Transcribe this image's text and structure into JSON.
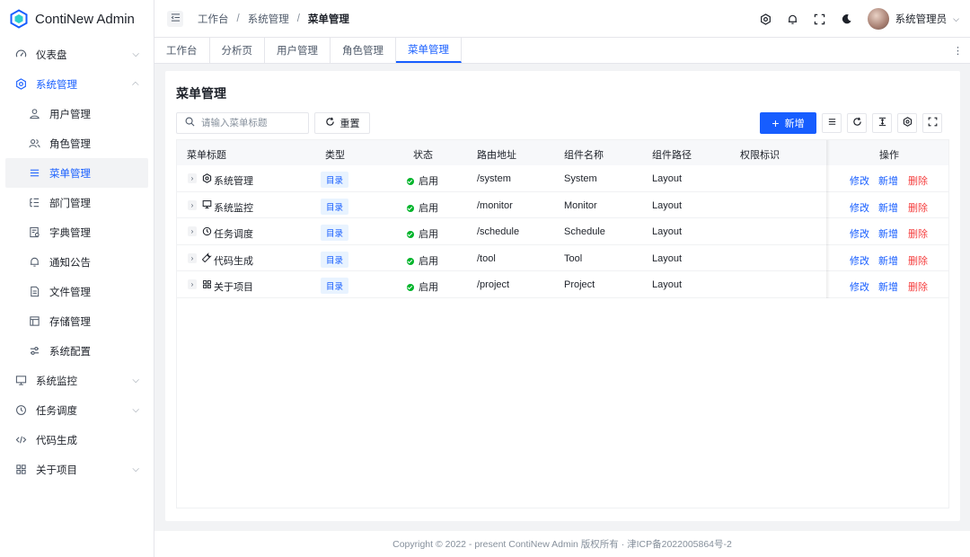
{
  "app": {
    "title": "ContiNew Admin"
  },
  "sidebar": {
    "items": [
      {
        "label": "仪表盘",
        "icon": "dashboard-icon",
        "has_children": true
      },
      {
        "label": "系统管理",
        "icon": "settings-icon",
        "has_children": true,
        "expanded": true
      },
      {
        "label": "用户管理",
        "icon": "user-icon"
      },
      {
        "label": "角色管理",
        "icon": "role-icon"
      },
      {
        "label": "菜单管理",
        "icon": "menu-icon",
        "active": true
      },
      {
        "label": "部门管理",
        "icon": "dept-icon"
      },
      {
        "label": "字典管理",
        "icon": "dict-icon"
      },
      {
        "label": "通知公告",
        "icon": "bell-icon"
      },
      {
        "label": "文件管理",
        "icon": "file-icon"
      },
      {
        "label": "存储管理",
        "icon": "storage-icon"
      },
      {
        "label": "系统配置",
        "icon": "config-icon"
      },
      {
        "label": "系统监控",
        "icon": "monitor-icon",
        "has_children": true
      },
      {
        "label": "任务调度",
        "icon": "clock-icon",
        "has_children": true
      },
      {
        "label": "代码生成",
        "icon": "code-icon"
      },
      {
        "label": "关于项目",
        "icon": "apps-icon",
        "has_children": true
      }
    ]
  },
  "header": {
    "breadcrumb": [
      "工作台",
      "系统管理",
      "菜单管理"
    ],
    "username": "系统管理员"
  },
  "tabs": [
    "工作台",
    "分析页",
    "用户管理",
    "角色管理",
    "菜单管理"
  ],
  "active_tab": "菜单管理",
  "page": {
    "title": "菜单管理",
    "search_placeholder": "请输入菜单标题",
    "reset_label": "重置",
    "add_label": "新增"
  },
  "table": {
    "columns": [
      "菜单标题",
      "类型",
      "状态",
      "路由地址",
      "组件名称",
      "组件路径",
      "权限标识",
      "操作"
    ],
    "rows": [
      {
        "title": "系统管理",
        "icon": "settings-icon",
        "type": "目录",
        "status": "启用",
        "route": "/system",
        "component_name": "System",
        "component_path": "Layout",
        "permission": ""
      },
      {
        "title": "系统监控",
        "icon": "monitor-icon",
        "type": "目录",
        "status": "启用",
        "route": "/monitor",
        "component_name": "Monitor",
        "component_path": "Layout",
        "permission": ""
      },
      {
        "title": "任务调度",
        "icon": "clock-icon",
        "type": "目录",
        "status": "启用",
        "route": "/schedule",
        "component_name": "Schedule",
        "component_path": "Layout",
        "permission": ""
      },
      {
        "title": "代码生成",
        "icon": "tool-icon",
        "type": "目录",
        "status": "启用",
        "route": "/tool",
        "component_name": "Tool",
        "component_path": "Layout",
        "permission": ""
      },
      {
        "title": "关于项目",
        "icon": "apps-icon",
        "type": "目录",
        "status": "启用",
        "route": "/project",
        "component_name": "Project",
        "component_path": "Layout",
        "permission": ""
      }
    ],
    "actions": {
      "edit": "修改",
      "add": "新增",
      "delete": "删除"
    }
  },
  "footer": {
    "text": "Copyright © 2022 - present ContiNew Admin 版权所有 · 津ICP备2022005864号-2"
  },
  "colors": {
    "primary": "#165dff",
    "danger": "#f53f3f",
    "success": "#00b42a",
    "bg": "#f2f3f5"
  }
}
